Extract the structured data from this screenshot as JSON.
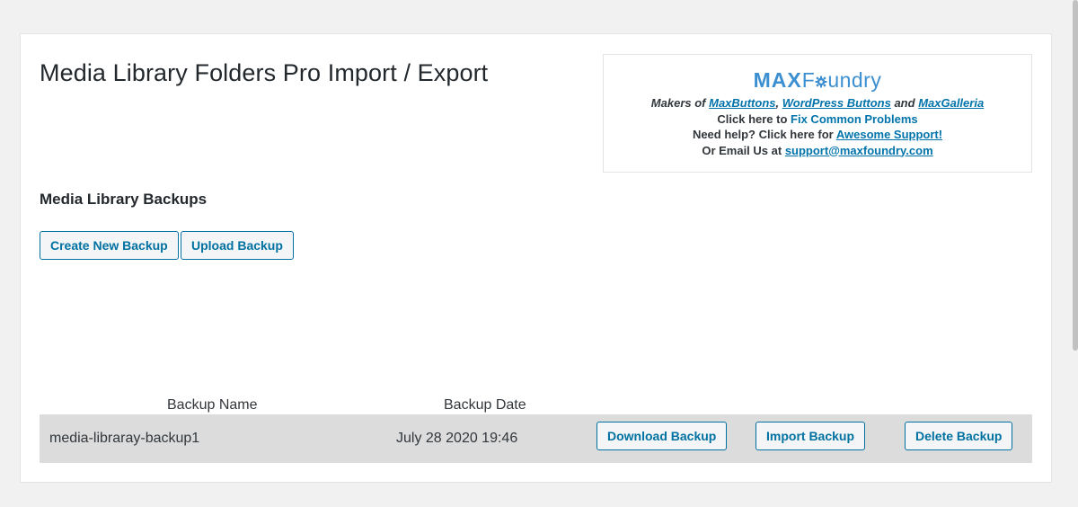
{
  "page": {
    "title": "Media Library Folders Pro Import / Export"
  },
  "promo": {
    "logo_max": "MAX",
    "logo_foundry_pre": "F",
    "logo_foundry_post": "undry",
    "makers_prefix": "Makers of ",
    "link_maxbuttons": "MaxButtons",
    "sep1": ", ",
    "link_wordpress_buttons": "WordPress Buttons",
    "sep2": " and ",
    "link_maxgalleria": "MaxGalleria",
    "fix_prefix": "Click here to ",
    "link_fix": "Fix Common Problems",
    "help_prefix": "Need help? Click here for ",
    "link_support": "Awesome Support!",
    "email_prefix": "Or Email Us at ",
    "link_email": "support@maxfoundry.com",
    "accent_color": "#3c8fd0"
  },
  "backups": {
    "section_title": "Media Library Backups",
    "create_label": "Create New Backup",
    "upload_label": "Upload Backup",
    "columns": [
      "Backup Name",
      "Backup Date"
    ],
    "rows": [
      {
        "name": "media-libraray-backup1",
        "date": "July 28 2020 19:46",
        "download_label": "Download Backup",
        "import_label": "Import Backup",
        "delete_label": "Delete Backup"
      }
    ]
  },
  "colors": {
    "button_text": "#0071a1",
    "row_background": "#dcdcdc",
    "page_background": "#f1f1f1"
  }
}
